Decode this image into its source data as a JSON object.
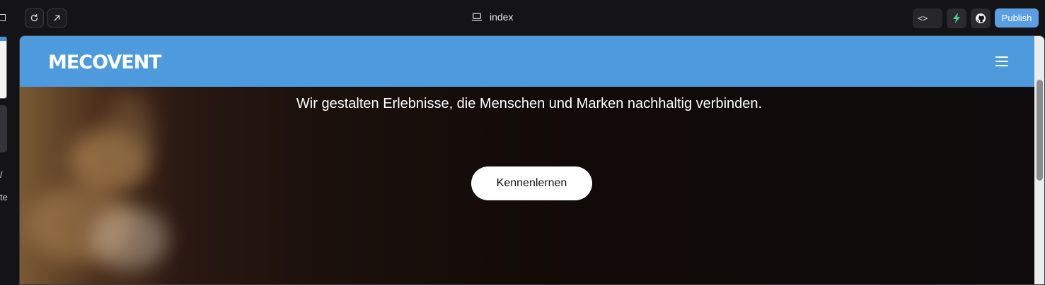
{
  "editor": {
    "tab_title": "index",
    "publish_label": "Publish",
    "code_toggle_label": "<>",
    "left_texts": [
      "/",
      "te"
    ],
    "icons": {
      "refresh": "refresh-icon",
      "open_external": "arrow-up-right-icon",
      "preview": "laptop-icon",
      "bolt": "bolt-icon",
      "github": "github-icon"
    }
  },
  "site": {
    "logo_text": "MECOVENT",
    "header_color": "#4d9bdd",
    "hero": {
      "headline": "Wir gestalten Erlebnisse, die Menschen und Marken nachhaltig verbinden.",
      "cta_label": "Kennenlernen"
    }
  }
}
